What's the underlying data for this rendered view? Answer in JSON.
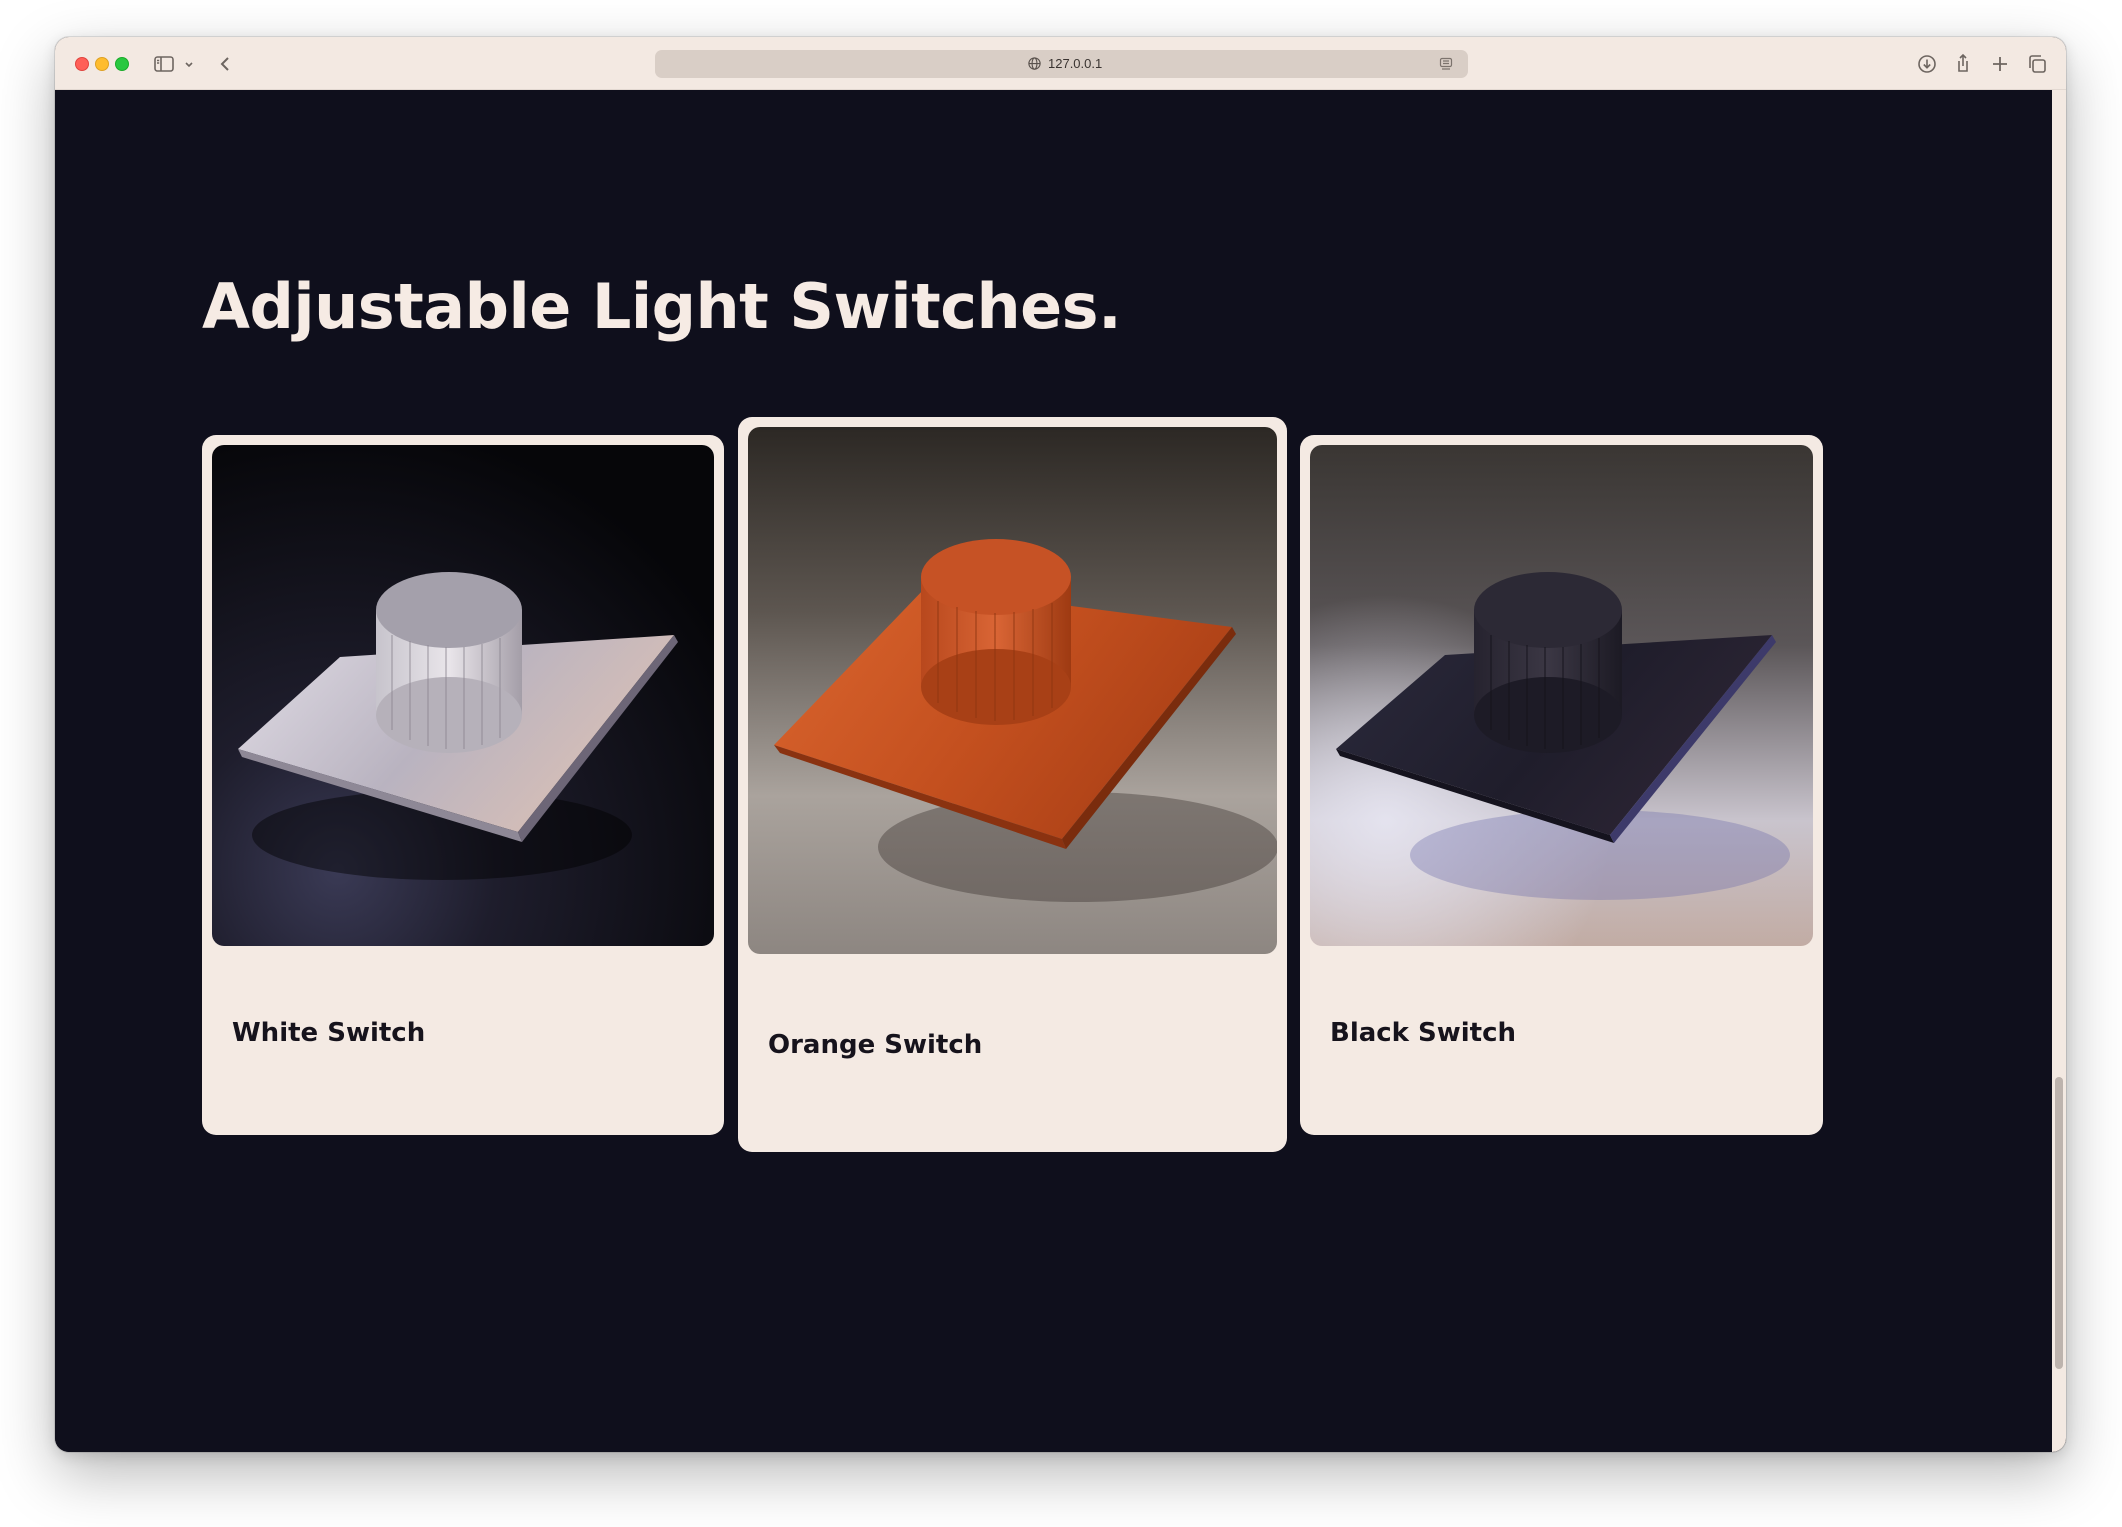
{
  "browser": {
    "url": "127.0.0.1",
    "icons": {
      "sidebar": "sidebar-icon",
      "sidebar_menu": "chevron-down-icon",
      "back": "chevron-left-icon",
      "site": "globe-icon",
      "reader": "reader-icon",
      "download": "download-icon",
      "share": "share-icon",
      "new_tab": "plus-icon",
      "tabs": "tabs-overview-icon"
    }
  },
  "page": {
    "heading": "Adjustable Light Switches.",
    "colors": {
      "background": "#0f0f1c",
      "card": "#f4eae3",
      "heading_text": "#f6ebe4",
      "card_text": "#16131c"
    },
    "cards": [
      {
        "label": "White Switch",
        "image": "white-switch-render"
      },
      {
        "label": "Orange Switch",
        "image": "orange-switch-render"
      },
      {
        "label": "Black Switch",
        "image": "black-switch-render"
      }
    ]
  }
}
